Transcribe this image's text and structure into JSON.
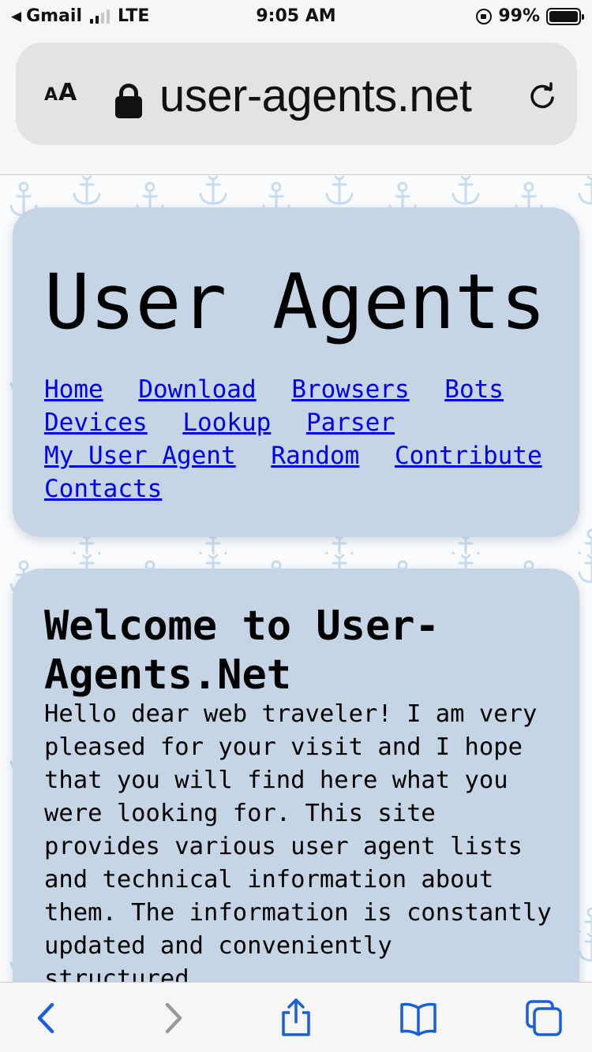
{
  "status_bar": {
    "back_app": "Gmail",
    "network": "LTE",
    "time": "9:05 AM",
    "battery": "99%",
    "icons": [
      "back-arrow-icon",
      "signal-icon",
      "orientation-lock-icon",
      "battery-icon"
    ]
  },
  "browser": {
    "text_size_label_small": "A",
    "text_size_label_large": "A",
    "url": "user-agents.net",
    "icons": [
      "lock-icon",
      "reload-icon"
    ]
  },
  "site": {
    "title": "User Agents",
    "nav": [
      "Home",
      "Download",
      "Browsers",
      "Bots",
      "Devices",
      "Lookup",
      "Parser",
      "My User Agent",
      "Random",
      "Contribute",
      "Contacts"
    ]
  },
  "welcome": {
    "title": "Welcome to User-Agents.Net",
    "text": "Hello dear web traveler! I am very pleased for your visit and I hope that you will find here what you were looking for. This site provides various user agent lists and technical information about them. The information is constantly updated and conveniently structured."
  },
  "toolbar": {
    "icons": [
      "back-icon",
      "forward-icon",
      "share-icon",
      "bookmarks-icon",
      "tabs-icon"
    ]
  },
  "colors": {
    "card_bg": "#c6d5e5",
    "link": "#0000ee",
    "toolbar_icon": "#1a5fd8",
    "toolbar_icon_disabled": "#999999",
    "pattern": "#cfe0f0"
  }
}
